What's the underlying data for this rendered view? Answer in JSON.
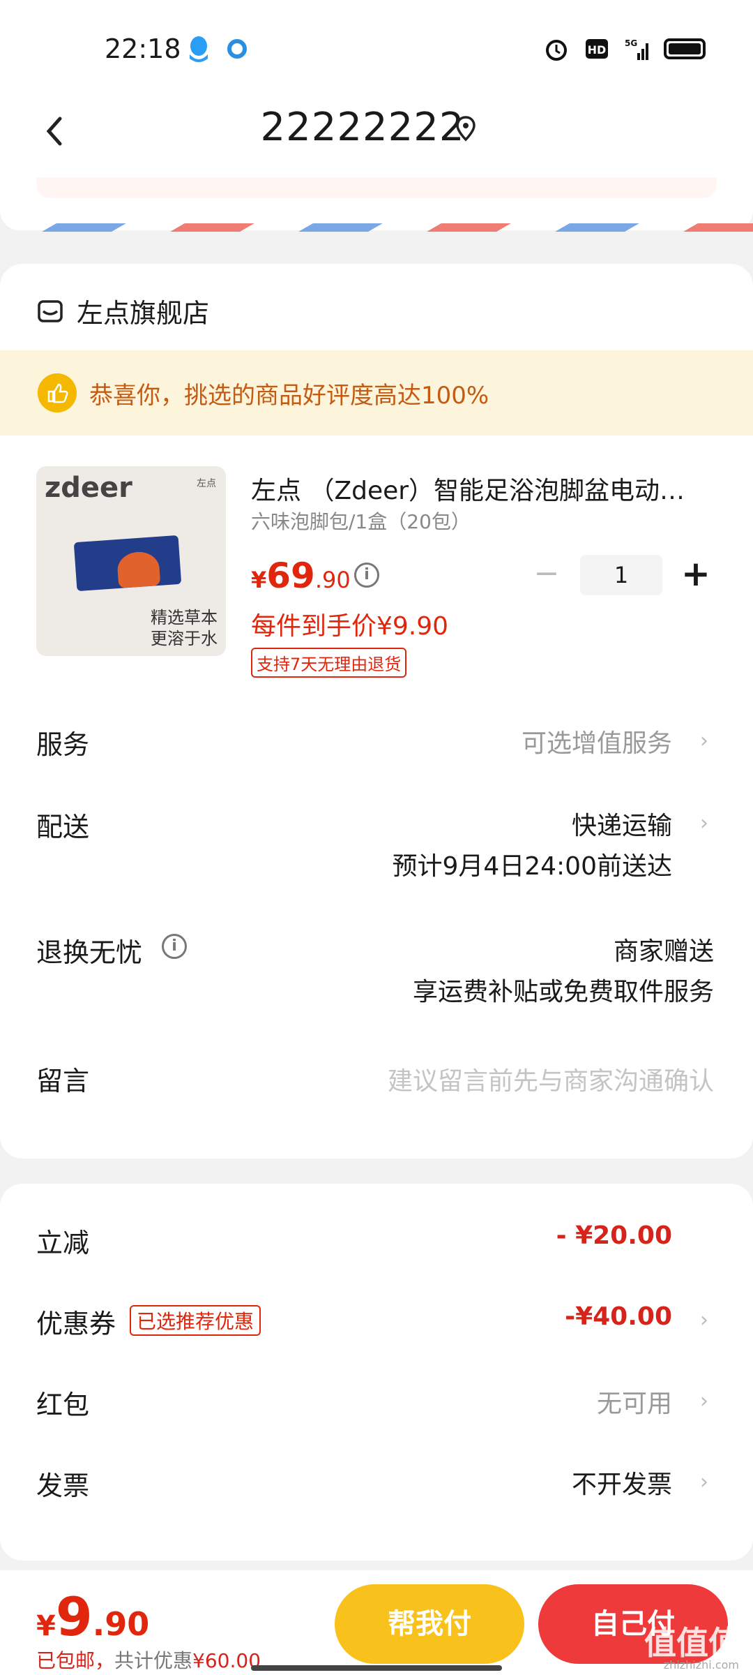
{
  "status_bar": {
    "time": "22:18"
  },
  "header": {
    "title": "22222222"
  },
  "shop": {
    "name": "左点旗舰店"
  },
  "banner": {
    "text": "恭喜你，挑选的商品好评度高达100%"
  },
  "product": {
    "image_brand": "zdeer",
    "image_mini": "左点",
    "image_caption_1": "精选草本",
    "image_caption_2": "更溶于水",
    "title": "左点 （Zdeer）智能足浴泡脚盆电动…",
    "spec": "六味泡脚包/1盒（20包）",
    "price_currency": "¥",
    "price_int": "69",
    "price_dec": ".90",
    "quantity": "1",
    "unit_price": "每件到手价¥9.90",
    "return_tag": "支持7天无理由退货"
  },
  "rows": {
    "service": {
      "label": "服务",
      "value": "可选增值服务"
    },
    "delivery": {
      "label": "配送",
      "value": "快递运输",
      "sub": "预计9月4日24:00前送达"
    },
    "returns": {
      "label": "退换无忧",
      "value": "商家赠送",
      "sub": "享运费补贴或免费取件服务"
    },
    "message": {
      "label": "留言",
      "placeholder": "建议留言前先与商家沟通确认"
    }
  },
  "discounts": {
    "instant": {
      "label": "立减",
      "value": "- ¥20.00"
    },
    "coupon": {
      "label": "优惠券",
      "tag": "已选推荐优惠",
      "value": "-¥40.00"
    },
    "redpacket": {
      "label": "红包",
      "value": "无可用"
    },
    "invoice": {
      "label": "发票",
      "value": "不开发票"
    }
  },
  "bottom": {
    "currency": "¥",
    "total_int": "9",
    "total_dec": ".90",
    "free_shipping": "已包邮，",
    "saved_label": "共计优惠",
    "saved_value": "¥60.00",
    "btn_help_pay": "帮我付",
    "btn_self_pay": "自己付"
  },
  "watermark": {
    "text": "值值值",
    "sub": "zhizhizhi.com"
  },
  "colors": {
    "accent_red": "#e0260d",
    "accent_yellow": "#f9c11b",
    "banner_bg": "#fdf4dc"
  }
}
